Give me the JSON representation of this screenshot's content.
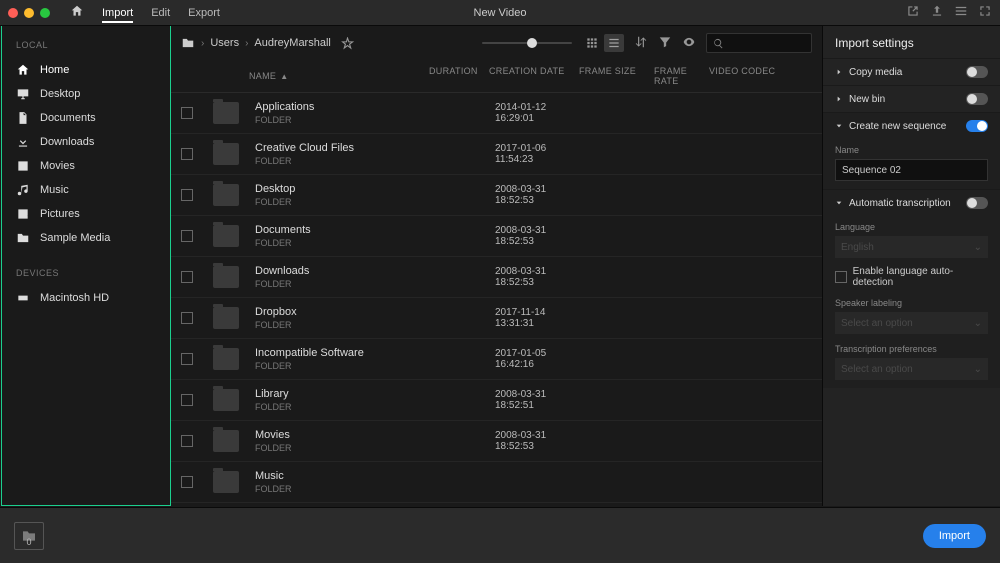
{
  "window_title": "New Video",
  "nav": {
    "tabs": [
      "Import",
      "Edit",
      "Export"
    ],
    "active": "Import"
  },
  "sidebar": {
    "local_label": "LOCAL",
    "devices_label": "DEVICES",
    "items": [
      {
        "label": "Home",
        "icon": "home"
      },
      {
        "label": "Desktop",
        "icon": "desktop"
      },
      {
        "label": "Documents",
        "icon": "document"
      },
      {
        "label": "Downloads",
        "icon": "download"
      },
      {
        "label": "Movies",
        "icon": "movies"
      },
      {
        "label": "Music",
        "icon": "music"
      },
      {
        "label": "Pictures",
        "icon": "pictures"
      },
      {
        "label": "Sample Media",
        "icon": "folder"
      }
    ],
    "devices": [
      {
        "label": "Macintosh HD",
        "icon": "hdd"
      }
    ]
  },
  "breadcrumb": {
    "parts": [
      "Users",
      "AudreyMarshall"
    ]
  },
  "columns": {
    "name": "NAME",
    "duration": "DURATION",
    "creation_date": "CREATION DATE",
    "frame_size": "FRAME SIZE",
    "frame_rate": "FRAME RATE",
    "video_codec": "VIDEO CODEC"
  },
  "folder_sub": "FOLDER",
  "rows": [
    {
      "name": "Applications",
      "created": "2014-01-12 16:29:01"
    },
    {
      "name": "Creative Cloud Files",
      "created": "2017-01-06 11:54:23"
    },
    {
      "name": "Desktop",
      "created": "2008-03-31 18:52:53"
    },
    {
      "name": "Documents",
      "created": "2008-03-31 18:52:53"
    },
    {
      "name": "Downloads",
      "created": "2008-03-31 18:52:53"
    },
    {
      "name": "Dropbox",
      "created": "2017-11-14 13:31:31"
    },
    {
      "name": "Incompatible Software",
      "created": "2017-01-05 16:42:16"
    },
    {
      "name": "Library",
      "created": "2008-03-31 18:52:51"
    },
    {
      "name": "Movies",
      "created": "2008-03-31 18:52:53"
    },
    {
      "name": "Music",
      "created": ""
    }
  ],
  "settings": {
    "title": "Import settings",
    "copy_media": "Copy media",
    "new_bin": "New bin",
    "create_seq": "Create new sequence",
    "name_label": "Name",
    "sequence_name": "Sequence 02",
    "auto_trans": "Automatic transcription",
    "language_label": "Language",
    "language_value": "English",
    "auto_detect": "Enable language auto-detection",
    "speaker_label": "Speaker labeling",
    "select_option": "Select an option",
    "trans_prefs": "Transcription preferences"
  },
  "tray_count": "0",
  "import_button": "Import"
}
